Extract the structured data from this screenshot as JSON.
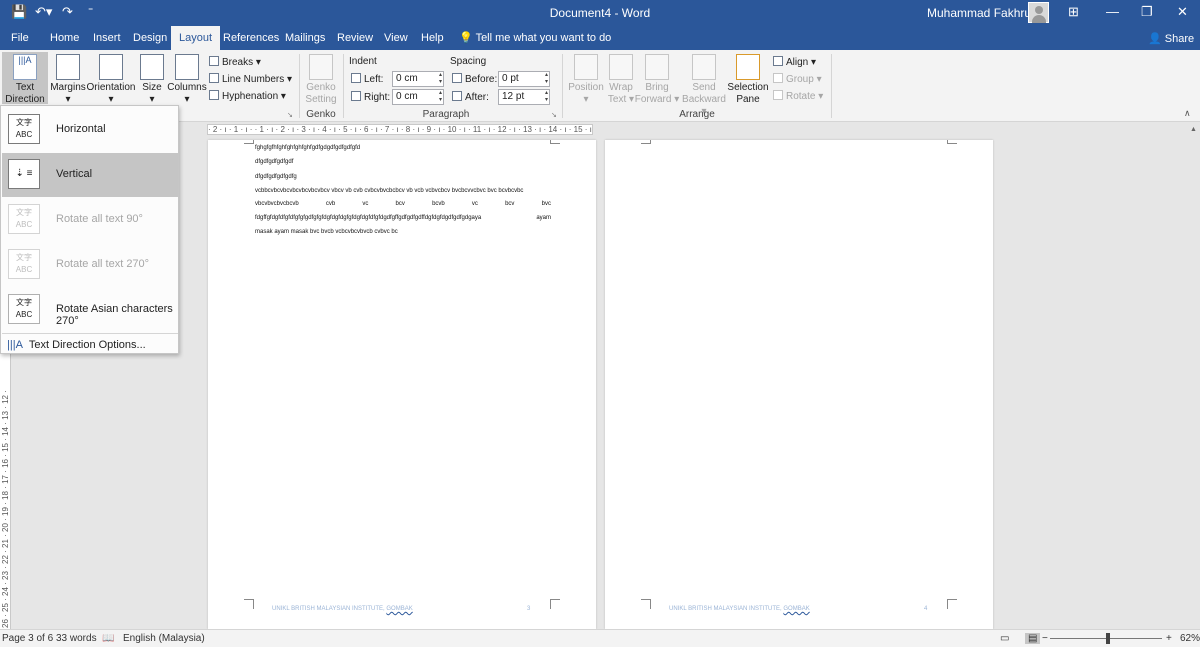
{
  "titlebar": {
    "title": "Document4 - Word",
    "user": "Muhammad Fakhrullah",
    "qa_save_icon": "save-icon",
    "qa_undo_icon": "undo-icon",
    "qa_redo_icon": "redo-icon"
  },
  "tabs": [
    "File",
    "Home",
    "Insert",
    "Design",
    "Layout",
    "References",
    "Mailings",
    "Review",
    "View",
    "Help"
  ],
  "tell_me": "Tell me what you want to do",
  "share": "Share",
  "ribbon": {
    "text_direction": [
      "Text",
      "Direction"
    ],
    "margins": "Margins",
    "orientation": "Orientation",
    "size": "Size",
    "columns": "Columns",
    "breaks": "Breaks",
    "line_numbers": "Line Numbers",
    "hyphenation": "Hyphenation",
    "genko": [
      "Genko",
      "Setting"
    ],
    "genko_group": "Genko",
    "indent": "Indent",
    "indent_left_label": "Left:",
    "indent_left_value": "0 cm",
    "indent_right_label": "Right:",
    "indent_right_value": "0 cm",
    "spacing": "Spacing",
    "before_label": "Before:",
    "before_value": "0 pt",
    "after_label": "After:",
    "after_value": "12 pt",
    "paragraph_group": "Paragraph",
    "position": "Position",
    "wrap_text": [
      "Wrap",
      "Text"
    ],
    "bring_forward": [
      "Bring",
      "Forward"
    ],
    "send_backward": [
      "Send",
      "Backward"
    ],
    "selection_pane": [
      "Selection",
      "Pane"
    ],
    "align": "Align",
    "group": "Group",
    "rotate": "Rotate",
    "arrange_group": "Arrange"
  },
  "dropdown": {
    "items": [
      {
        "label": "Horizontal",
        "icon_text": "文字 ABC"
      },
      {
        "label": "Vertical",
        "icon_text": "⇣ ≡"
      },
      {
        "label": "Rotate all text 90°",
        "icon_text": "文字 ABC"
      },
      {
        "label": "Rotate all text 270°",
        "icon_text": "文字 ABC"
      },
      {
        "label": "Rotate Asian characters 270°",
        "icon_text": "文字 ABC"
      }
    ],
    "options": "Text Direction Options..."
  },
  "ruler": {
    "h": "· 2 · ı · 1 · ı ·   · 1 · ı · 2 · ı · 3 · ı · 4 · ı · 5 · ı · 6 · ı · 7 · ı · 8 · ı · 9 · ı · 10 · ı · 11 · ı · 12 · ı · 13 · ı · 14 · ı · 15 · ı ·   · 17 · 18",
    "v": "26 · 25 · 24 · 23 · 22 · 21 · 20 · 19 · 18 · 17 · 16 · 15 · 14 · 13 · 12 ·"
  },
  "document": {
    "lines": [
      "fghgfgfhfghfghfghfghfgdfgdgdfgdfgdfgfd",
      "dfgdfgdfgdfgdf",
      "dfgdfgdfgdfgdfg",
      "vcbbcvbcvbcvbcvbcvbcvbcv vbcv vb cvb cvbcvbvcbcbcv vb vcb vcbvcbcv bvcbcvvcbvc bvc bcvbcvbc",
      "fdgffgfdgfdfgfdfgfgfgdfgfgfdgfdgfdgfgfdgfdgfdfgfdgdfgffgdfgdfgdffdgfdgfdgdfgdfgdgaya",
      "masak ayam masak bvc bvcb vcbcvbcvbvcb cvbvc bc"
    ],
    "justified_words": [
      "vbcvbvcbvcbcvb",
      "cvb",
      "vc",
      "bcv",
      "bcvb",
      "vc",
      "bcv",
      "bvc"
    ],
    "line5_tail": "ayam",
    "footer": "UNIKL BRITISH MALAYSIAN INSTITUTE, ",
    "footer_underlined": "GOMBAK",
    "page_num_1": "3",
    "page_num_2": "4"
  },
  "statusbar": {
    "page": "Page 3 of 6",
    "words": "33 words",
    "language": "English (Malaysia)",
    "zoom": "62%"
  },
  "colors": {
    "brand": "#2b579a",
    "ribbon": "#f3f3f3",
    "hover": "#c5c5c5"
  }
}
